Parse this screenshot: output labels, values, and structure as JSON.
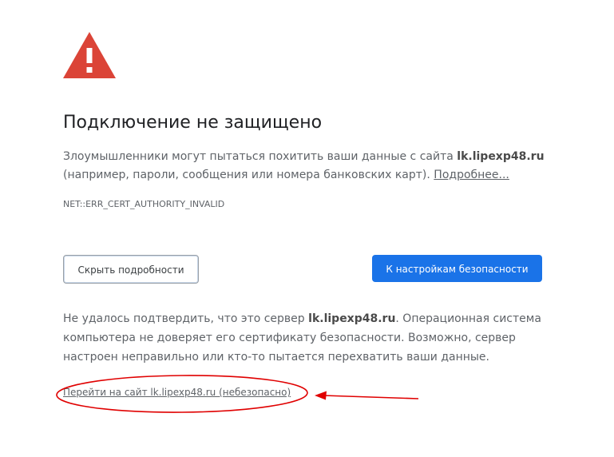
{
  "page": {
    "heading": "Подключение не защищено",
    "main_message": {
      "part1": "Злоумышленники могут пытаться похитить ваши данные с сайта ",
      "domain": "lk.lipexp48.ru",
      "part2": " (например, пароли, сообщения или номера банковских карт). ",
      "details_link": "Подробнее..."
    },
    "error_code": "NET::ERR_CERT_AUTHORITY_INVALID",
    "buttons": {
      "hide_details": "Скрыть подробности",
      "back_to_safety": "К настройкам безопасности"
    },
    "details": {
      "part1": "Не удалось подтвердить, что это сервер ",
      "domain": "lk.lipexp48.ru",
      "part2": ". Операционная система компьютера не доверяет его сертификату безопасности. Возможно, сервер настроен неправильно или кто-то пытается перехватить ваши данные."
    },
    "proceed_link": "Перейти на сайт lk.lipexp48.ru (небезопасно)"
  },
  "icons": {
    "warning": "warning-triangle-icon"
  },
  "colors": {
    "warning_red": "#db4437",
    "primary_blue": "#1a73e8",
    "annotation_red": "#e00000"
  }
}
